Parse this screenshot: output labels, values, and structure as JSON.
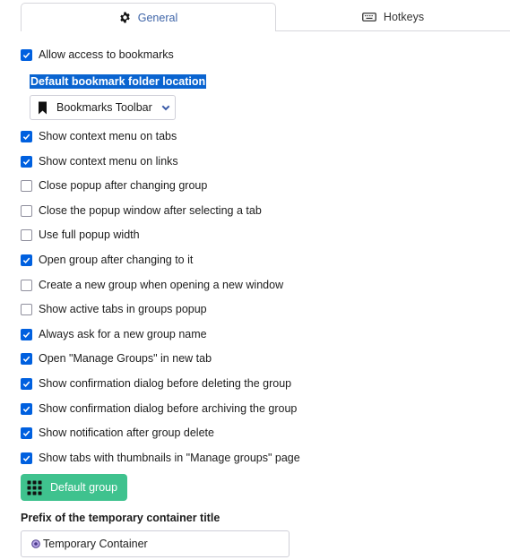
{
  "tabs": [
    {
      "label": "General",
      "icon": "gear-icon",
      "active": true
    },
    {
      "label": "Hotkeys",
      "icon": "keyboard-icon",
      "active": false
    }
  ],
  "options_top": [
    {
      "label": "Allow access to bookmarks",
      "checked": true
    }
  ],
  "bookmark_folder": {
    "label": "Default bookmark folder location",
    "selected": "Bookmarks Toolbar",
    "icon": "bookmark-icon"
  },
  "options": [
    {
      "label": "Show context menu on tabs",
      "checked": true
    },
    {
      "label": "Show context menu on links",
      "checked": true
    },
    {
      "label": "Close popup after changing group",
      "checked": false
    },
    {
      "label": "Close the popup window after selecting a tab",
      "checked": false
    },
    {
      "label": "Use full popup width",
      "checked": false
    },
    {
      "label": "Open group after changing to it",
      "checked": true
    },
    {
      "label": "Create a new group when opening a new window",
      "checked": false
    },
    {
      "label": "Show active tabs in groups popup",
      "checked": false
    },
    {
      "label": "Always ask for a new group name",
      "checked": true
    },
    {
      "label": "Open \"Manage Groups\" in new tab",
      "checked": true
    },
    {
      "label": "Show confirmation dialog before deleting the group",
      "checked": true
    },
    {
      "label": "Show confirmation dialog before archiving the group",
      "checked": true
    },
    {
      "label": "Show notification after group delete",
      "checked": true
    },
    {
      "label": "Show tabs with thumbnails in \"Manage groups\" page",
      "checked": true
    }
  ],
  "default_group_button": {
    "label": "Default group",
    "icon": "grid-icon"
  },
  "prefix": {
    "label": "Prefix of the temporary container title",
    "value": "Temporary Container",
    "icon": "container-icon"
  },
  "colors": {
    "accent": "#0060df",
    "tab_active_text": "#3f65a8",
    "button_green": "#3fc28e",
    "selection": "#0a64d0"
  }
}
